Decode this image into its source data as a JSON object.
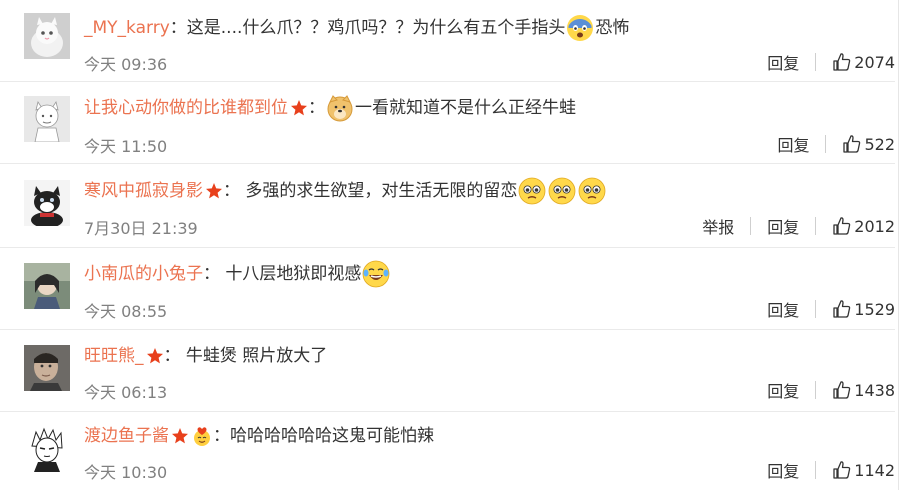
{
  "reply_label": "回复",
  "report_label": "举报",
  "comments": [
    {
      "user": "_MY_karry",
      "text_before": "这是....什么爪？？鸡爪吗？？为什么有五个手指头",
      "text_after": "恐怖",
      "time": "今天 09:36",
      "likes": "2074"
    },
    {
      "user": "让我心动你做的比谁都到位",
      "text_before": "",
      "text_after": "一看就知道不是什么正经牛蛙",
      "time": "今天 11:50",
      "likes": "522"
    },
    {
      "user": "寒风中孤寂身影",
      "text_before": "多强的求生欲望，对生活无限的留恋",
      "text_after": "",
      "time": "7月30日 21:39",
      "likes": "2012"
    },
    {
      "user": "小南瓜的小兔子",
      "text_before": "十八层地狱即视感",
      "text_after": "",
      "time": "今天 08:55",
      "likes": "1529"
    },
    {
      "user": "旺旺熊_",
      "text_before": "牛蛙煲 照片放大了",
      "text_after": "",
      "time": "今天 06:13",
      "likes": "1438"
    },
    {
      "user": "渡边鱼子酱",
      "text_before": "哈哈哈哈哈哈这鬼可能怕辣",
      "text_after": "",
      "time": "今天 10:30",
      "likes": "1142"
    }
  ]
}
